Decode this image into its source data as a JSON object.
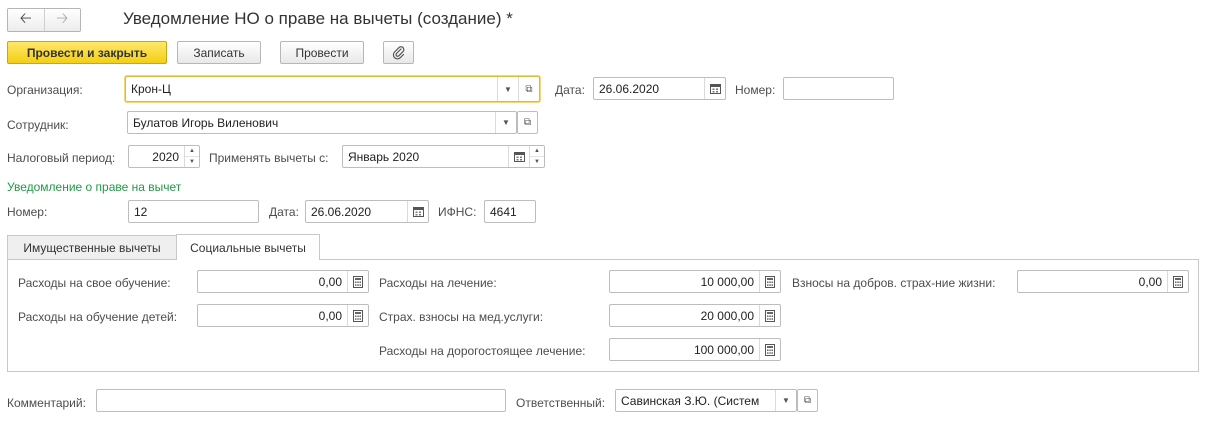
{
  "window": {
    "title": "Уведомление НО о праве на вычеты (создание) *",
    "nav_back_icon": "arrow-left-icon",
    "nav_forward_icon": "arrow-right-icon"
  },
  "toolbar": {
    "post_close_label": "Провести и закрыть",
    "save_label": "Записать",
    "post_label": "Провести",
    "attach_icon": "paperclip-icon"
  },
  "header": {
    "organization_label": "Организация:",
    "organization_value": "Крон-Ц",
    "date_label": "Дата:",
    "date_value": "26.06.2020",
    "number_label": "Номер:",
    "number_value": "",
    "employee_label": "Сотрудник:",
    "employee_value": "Булатов Игорь Виленович",
    "tax_period_label": "Налоговый период:",
    "tax_period_value": "2020",
    "apply_from_label": "Применять вычеты с:",
    "apply_from_value": "Январь 2020"
  },
  "notice": {
    "section_title": "Уведомление о праве на вычет",
    "number_label": "Номер:",
    "number_value": "12",
    "date_label": "Дата:",
    "date_value": "26.06.2020",
    "ifns_label": "ИФНС:",
    "ifns_value": "4641"
  },
  "tabs": [
    {
      "label": "Имущественные вычеты",
      "active": false
    },
    {
      "label": "Социальные вычеты",
      "active": true
    }
  ],
  "social": {
    "own_education_label": "Расходы на свое обучение:",
    "own_education_value": "0,00",
    "children_education_label": "Расходы на обучение детей:",
    "children_education_value": "0,00",
    "treatment_label": "Расходы на лечение:",
    "treatment_value": "10 000,00",
    "med_insurance_label": "Страх. взносы на мед.услуги:",
    "med_insurance_value": "20 000,00",
    "expensive_treatment_label": "Расходы на дорогостоящее лечение:",
    "expensive_treatment_value": "100 000,00",
    "life_insurance_label": "Взносы на добров. страх-ние жизни:",
    "life_insurance_value": "0,00"
  },
  "footer": {
    "comment_label": "Комментарий:",
    "comment_value": "",
    "responsible_label": "Ответственный:",
    "responsible_value": "Савинская З.Ю. (Систем"
  },
  "colors": {
    "primary_button": "#f4cf12",
    "section_title": "#1f9a44",
    "focus_border": "#e5b839"
  }
}
